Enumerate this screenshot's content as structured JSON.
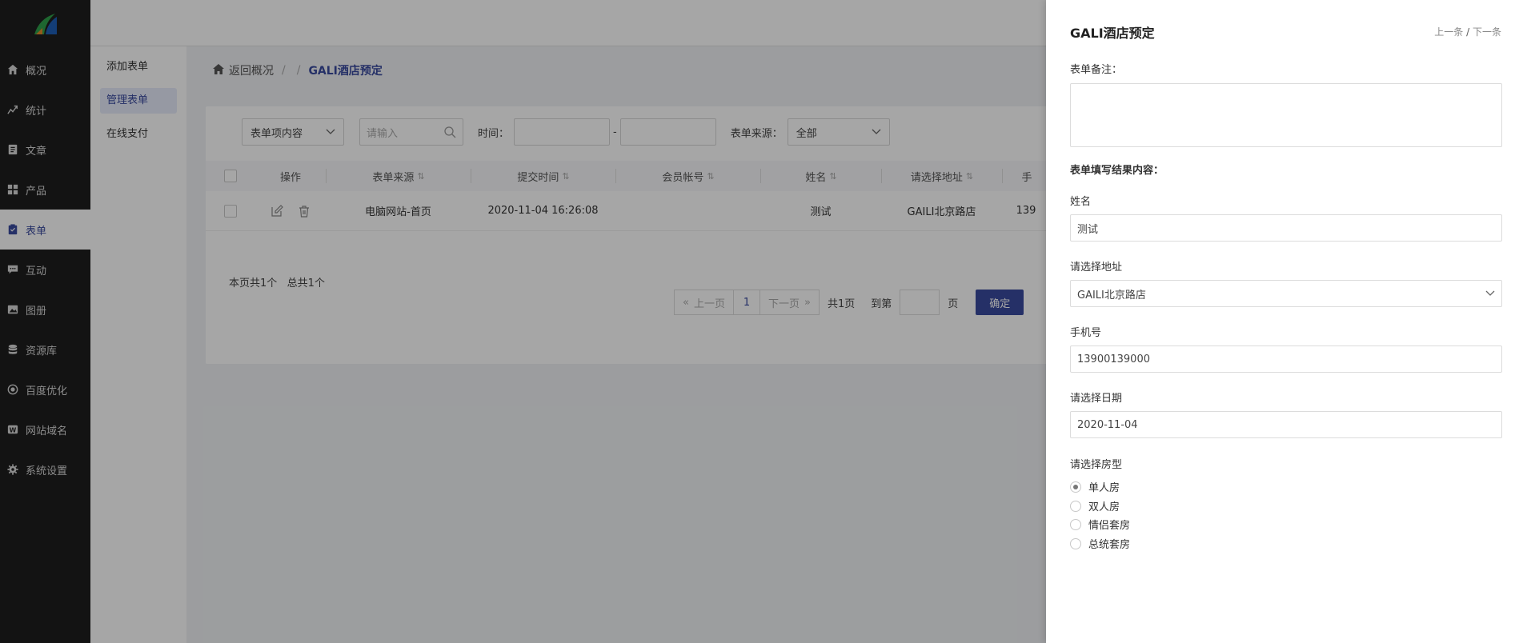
{
  "nav": {
    "items": [
      {
        "label": "概况",
        "icon": "home-icon"
      },
      {
        "label": "统计",
        "icon": "chart-icon"
      },
      {
        "label": "文章",
        "icon": "article-icon"
      },
      {
        "label": "产品",
        "icon": "grid-icon"
      },
      {
        "label": "表单",
        "icon": "clipboard-icon"
      },
      {
        "label": "互动",
        "icon": "chat-icon"
      },
      {
        "label": "图册",
        "icon": "image-icon"
      },
      {
        "label": "资源库",
        "icon": "database-icon"
      },
      {
        "label": "百度优化",
        "icon": "target-icon"
      },
      {
        "label": "网站域名",
        "icon": "domain-icon"
      },
      {
        "label": "系统设置",
        "icon": "gear-icon"
      }
    ],
    "active_index": 4
  },
  "subnav": {
    "items": [
      "添加表单",
      "管理表单",
      "在线支付"
    ],
    "active_index": 1
  },
  "breadcrumb": {
    "back": "返回概况",
    "sep": "/",
    "current": "GALI酒店预定"
  },
  "filter": {
    "field_select": "表单项内容",
    "search_placeholder": "请输入",
    "time_label": "时间：",
    "range_sep": "-",
    "source_label": "表单来源：",
    "source_select": "全部"
  },
  "table": {
    "headers": [
      "操作",
      "表单来源",
      "提交时间",
      "会员帐号",
      "姓名",
      "请选择地址",
      "手"
    ],
    "rows": [
      {
        "source": "电脑网站-首页",
        "time": "2020-11-04 16:26:08",
        "member": "",
        "name": "测试",
        "address": "GAILI北京路店",
        "phone": "139"
      }
    ]
  },
  "summary": "本页共1个   总共1个",
  "pager": {
    "prev": "上一页",
    "page": "1",
    "next": "下一页",
    "total": "共1页",
    "goto_label": "到第",
    "page_unit": "页",
    "confirm": "确定"
  },
  "drawer": {
    "title": "GALI酒店预定",
    "prev": "上一条",
    "slash": "/",
    "next": "下一条",
    "note_label": "表单备注：",
    "result_label": "表单填写结果内容：",
    "fields": {
      "name_label": "姓名",
      "name_value": "测试",
      "address_label": "请选择地址",
      "address_value": "GAILI北京路店",
      "phone_label": "手机号",
      "phone_value": "13900139000",
      "date_label": "请选择日期",
      "date_value": "2020-11-04",
      "room_label": "请选择房型"
    },
    "room_options": [
      "单人房",
      "双人房",
      "情侣套房",
      "总统套房"
    ],
    "room_selected": 0
  },
  "colors": {
    "accent": "#3a4a9e",
    "nav_bg": "#1e1e1e",
    "logo_green": "#2e9e4a",
    "logo_blue": "#1e5eb5",
    "logo_orange": "#e08a2c"
  }
}
